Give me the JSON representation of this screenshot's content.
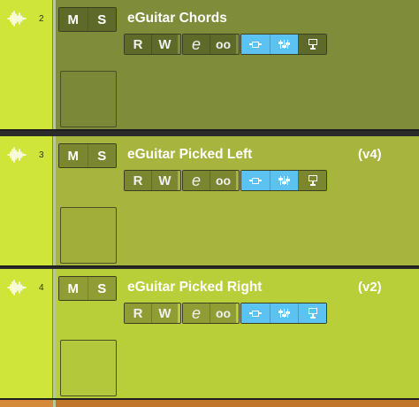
{
  "tracks": [
    {
      "number": "2",
      "name": "eGuitar Chords",
      "version": "",
      "mute": "M",
      "solo": "S",
      "read": "R",
      "write": "W",
      "edit": "e",
      "link": "oo",
      "color": "#7f8c3a"
    },
    {
      "number": "3",
      "name": "eGuitar Picked Left",
      "version": "(v4)",
      "mute": "M",
      "solo": "S",
      "read": "R",
      "write": "W",
      "edit": "e",
      "link": "oo",
      "color": "#a7b43d"
    },
    {
      "number": "4",
      "name": "eGuitar Picked Right",
      "version": "(v2)",
      "mute": "M",
      "solo": "S",
      "read": "R",
      "write": "W",
      "edit": "e",
      "link": "oo",
      "color": "#b9cf3a"
    }
  ],
  "icons": {
    "waveform": "waveform-icon",
    "input_monitor": "input-icon",
    "mixer": "sliders-icon",
    "screen": "monitor-screen-icon"
  },
  "colors": {
    "lane": "#cfe53a",
    "monitor_active": "#5cc2f2",
    "next_track": "#c0752a"
  }
}
